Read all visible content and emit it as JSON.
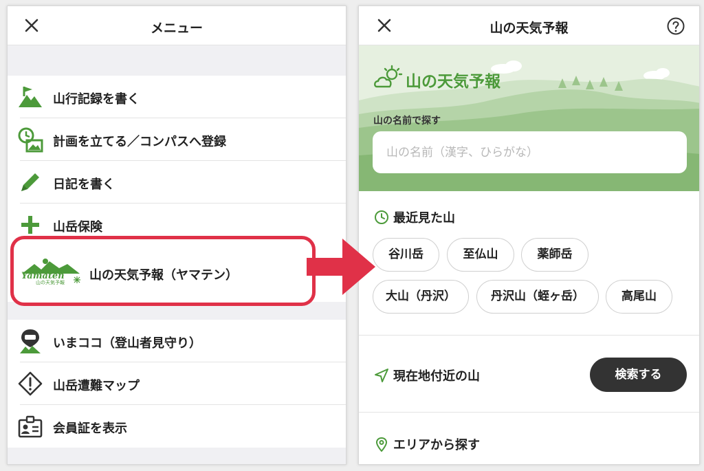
{
  "colors": {
    "accent_green": "#4c9a3a",
    "highlight_red": "#e03148",
    "dark_button": "#333333"
  },
  "menu": {
    "title": "メニュー",
    "items": [
      {
        "label": "山行記録を書く",
        "icon": "mountain-flag-icon"
      },
      {
        "label": "計画を立てる／コンパスへ登録",
        "icon": "plan-clock-mountain-icon"
      },
      {
        "label": "日記を書く",
        "icon": "pencil-icon"
      },
      {
        "label": "山岳保険",
        "icon": "plus-icon"
      },
      {
        "label": "山の天気予報（ヤマテン）",
        "icon": "yamaten-logo"
      },
      {
        "label": "いまココ（登山者見守り）",
        "icon": "imakoko-pin-icon"
      },
      {
        "label": "山岳遭難マップ",
        "icon": "warning-diamond-icon"
      },
      {
        "label": "会員証を表示",
        "icon": "member-card-icon"
      }
    ],
    "yamaten_logo": {
      "wordmark": "Yamaten",
      "sub": "山の天気予報"
    }
  },
  "weather": {
    "header_title": "山の天気予報",
    "hero_title": "山の天気予報",
    "search_label": "山の名前で探す",
    "search_placeholder": "山の名前（漢字、ひらがな）",
    "recent_title": "最近見た山",
    "recent_mountains": [
      "谷川岳",
      "至仏山",
      "薬師岳",
      "大山（丹沢）",
      "丹沢山（蛭ヶ岳）",
      "高尾山"
    ],
    "nearby_title": "現在地付近の山",
    "search_button": "検索する",
    "area_title": "エリアから探す"
  }
}
